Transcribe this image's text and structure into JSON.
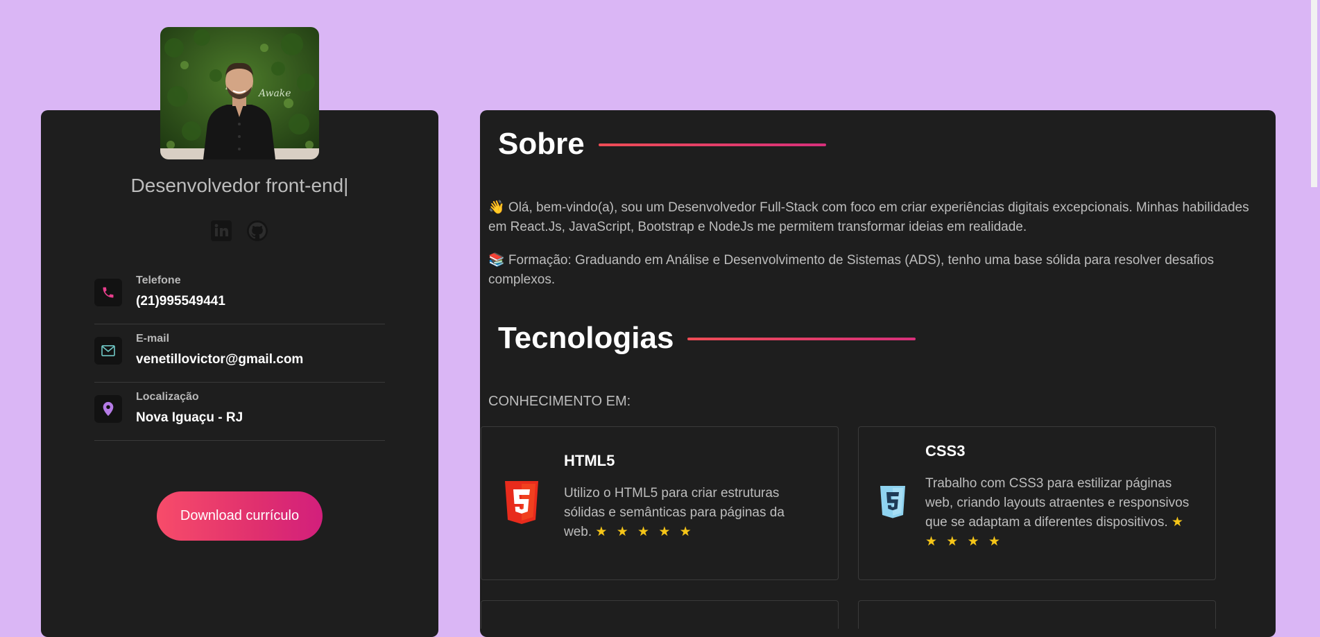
{
  "profile": {
    "role": "Desenvolvedor front-end|",
    "socials": [
      "linkedin-icon",
      "github-icon"
    ],
    "contacts": [
      {
        "label": "Telefone",
        "value": "(21)995549441",
        "icon": "phone-icon"
      },
      {
        "label": "E-mail",
        "value": "venetillovictor@gmail.com",
        "icon": "mail-icon"
      },
      {
        "label": "Localização",
        "value": "Nova Iguaçu - RJ",
        "icon": "location-pin-icon"
      }
    ],
    "download_label": "Download currículo"
  },
  "about": {
    "title": "Sobre",
    "p1": "👋 Olá, bem-vindo(a), sou um Desenvolvedor Full-Stack com foco em criar experiências digitais excepcionais. Minhas habilidades em React.Js, JavaScript, Bootstrap e NodeJs me permitem transformar ideias em realidade.",
    "p2": "📚 Formação: Graduando em Análise e Desenvolvimento de Sistemas (ADS), tenho uma base sólida para resolver desafios complexos."
  },
  "tech": {
    "title": "Tecnologias",
    "subtitle": "CONHECIMENTO EM:",
    "cards": [
      {
        "name": "HTML5",
        "desc": "Utilizo o HTML5 para criar estruturas sólidas e semânticas para páginas da web.",
        "stars": "★ ★ ★ ★ ★",
        "rating": 5
      },
      {
        "name": "CSS3",
        "desc": "Trabalho com CSS3 para estilizar páginas web, criando layouts atraentes e responsivos que se adaptam a diferentes dispositivos.",
        "stars": "★ ★ ★ ★ ★",
        "rating": 5
      }
    ]
  },
  "colors": {
    "background": "#dab6f5",
    "card": "#1e1e1e",
    "accent_start": "#f74c6a",
    "accent_end": "#d21f7c"
  }
}
